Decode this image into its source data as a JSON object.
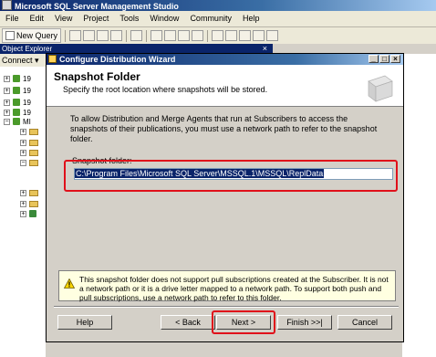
{
  "app": {
    "title": "Microsoft SQL Server Management Studio",
    "menu": [
      "File",
      "Edit",
      "View",
      "Project",
      "Tools",
      "Window",
      "Community",
      "Help"
    ],
    "new_query_label": "New Query"
  },
  "object_explorer": {
    "title": "Object Explorer",
    "close_glyph": "× ",
    "connect_label": "Connect ▾",
    "server_prefix": "19",
    "db_prefix": "MI"
  },
  "dialog": {
    "title": "Configure Distribution Wizard",
    "heading": "Snapshot Folder",
    "subheading": "Specify the root location where snapshots will be stored.",
    "description": "To allow Distribution and Merge Agents that run at Subscribers to access the snapshots of their publications, you must use a network path to refer to the snapshot folder.",
    "snapshot_label": "Snapshot folder:",
    "snapshot_value": "C:\\Program Files\\Microsoft SQL Server\\MSSQL.1\\MSSQL\\ReplData",
    "warning": "This snapshot folder does not support pull subscriptions created at the Subscriber. It is not a network path or it is a drive letter mapped to a network path. To support both push and pull subscriptions, use a network path to refer to this folder.",
    "buttons": {
      "help": "Help",
      "back": "< Back",
      "next": "Next >",
      "finish": "Finish >>|",
      "cancel": "Cancel"
    },
    "window_buttons": {
      "minimize": "_",
      "maximize": "□",
      "close": "×"
    }
  },
  "colors": {
    "highlight": "#e0101a",
    "title_bar": "#0a246a"
  }
}
